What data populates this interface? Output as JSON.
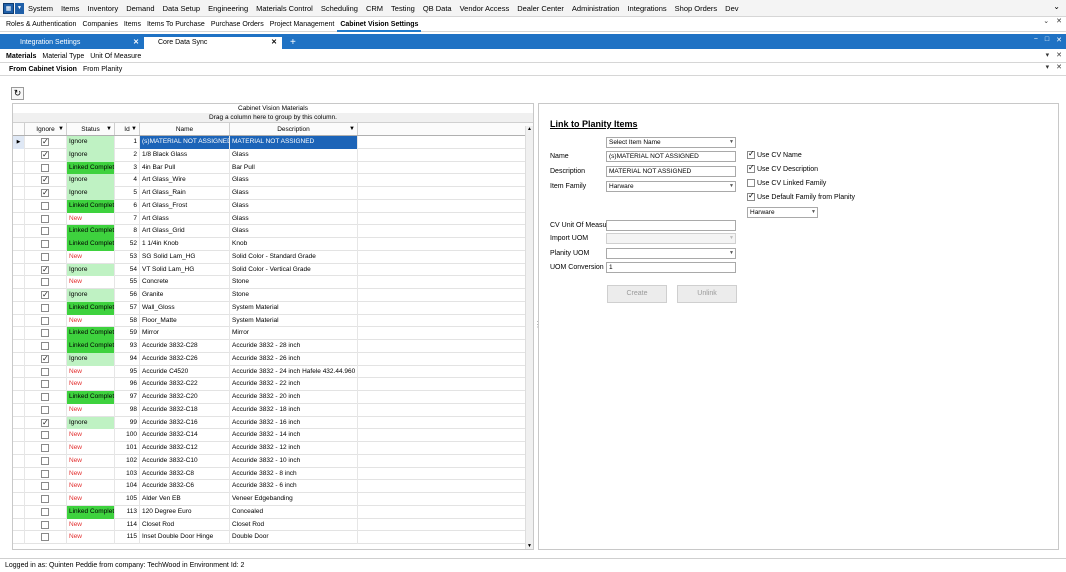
{
  "menubar": {
    "items": [
      "System",
      "Items",
      "Inventory",
      "Demand",
      "Data Setup",
      "Engineering",
      "Materials Control",
      "Scheduling",
      "CRM",
      "Testing",
      "QB Data",
      "Vendor Access",
      "Dealer Center",
      "Administration",
      "Integrations",
      "Shop Orders",
      "Dev"
    ],
    "collapse_glyph": "⌄"
  },
  "secnav": {
    "items": [
      "Roles & Authentication",
      "Companies",
      "Items",
      "Items To Purchase",
      "Purchase Orders",
      "Project Management",
      "Cabinet Vision Settings"
    ],
    "active_index": 6
  },
  "doc_tabs": {
    "tabs": [
      {
        "label": "Integration Settings",
        "active": false
      },
      {
        "label": "Core Data Sync",
        "active": true
      }
    ],
    "add": "+"
  },
  "sub_tabs": {
    "items": [
      "Materials",
      "Material Type",
      "Unit Of Measure"
    ],
    "active_index": 0
  },
  "source_tabs": {
    "items": [
      "From Cabinet Vision",
      "From Planity"
    ],
    "active_index": 0
  },
  "grid": {
    "title": "Cabinet Vision Materials",
    "drag_hint": "Drag a column here to group by this column.",
    "columns": [
      "Ignore",
      "Status",
      "Id",
      "Name",
      "Description"
    ],
    "rows": [
      {
        "ignore": true,
        "status": "Ignore",
        "id": "1",
        "name": "(s)MATERIAL NOT ASSIGNED",
        "desc": "MATERIAL NOT ASSIGNED",
        "selected": true
      },
      {
        "ignore": true,
        "status": "Ignore",
        "id": "2",
        "name": "1/8 Black Glass",
        "desc": "Glass"
      },
      {
        "ignore": false,
        "status": "Linked Complete",
        "id": "3",
        "name": "4in Bar Pull",
        "desc": "Bar Pull"
      },
      {
        "ignore": true,
        "status": "Ignore",
        "id": "4",
        "name": "Art Glass_Wire",
        "desc": "Glass"
      },
      {
        "ignore": true,
        "status": "Ignore",
        "id": "5",
        "name": "Art Glass_Rain",
        "desc": "Glass"
      },
      {
        "ignore": false,
        "status": "Linked Complete",
        "id": "6",
        "name": "Art Glass_Frost",
        "desc": "Glass"
      },
      {
        "ignore": false,
        "status": "New",
        "id": "7",
        "name": "Art Glass",
        "desc": "Glass"
      },
      {
        "ignore": false,
        "status": "Linked Complete",
        "id": "8",
        "name": "Art Glass_Grid",
        "desc": "Glass"
      },
      {
        "ignore": false,
        "status": "Linked Complete",
        "id": "52",
        "name": "1 1/4in Knob",
        "desc": "Knob"
      },
      {
        "ignore": false,
        "status": "New",
        "id": "53",
        "name": "SG Solid Lam_HG",
        "desc": "Solid Color - Standard Grade"
      },
      {
        "ignore": true,
        "status": "Ignore",
        "id": "54",
        "name": "VT Solid Lam_HG",
        "desc": "Solid Color - Vertical Grade"
      },
      {
        "ignore": false,
        "status": "New",
        "id": "55",
        "name": "Concrete",
        "desc": "Stone"
      },
      {
        "ignore": true,
        "status": "Ignore",
        "id": "56",
        "name": "Granite",
        "desc": "Stone"
      },
      {
        "ignore": false,
        "status": "Linked Complete",
        "id": "57",
        "name": "Wall_Gloss",
        "desc": "System Material"
      },
      {
        "ignore": false,
        "status": "New",
        "id": "58",
        "name": "Floor_Matte",
        "desc": "System Material"
      },
      {
        "ignore": false,
        "status": "Linked Complete",
        "id": "59",
        "name": "Mirror",
        "desc": "Mirror"
      },
      {
        "ignore": false,
        "status": "Linked Complete",
        "id": "93",
        "name": "Accuride 3832-C28",
        "desc": "Accuride 3832 - 28 inch"
      },
      {
        "ignore": true,
        "status": "Ignore",
        "id": "94",
        "name": "Accuride 3832-C26",
        "desc": "Accuride 3832 - 26 inch"
      },
      {
        "ignore": false,
        "status": "New",
        "id": "95",
        "name": "Accuride C4520",
        "desc": "Accuride 3832 - 24 inch Hafele 432.44.960"
      },
      {
        "ignore": false,
        "status": "New",
        "id": "96",
        "name": "Accuride 3832-C22",
        "desc": "Accuride 3832 - 22 inch"
      },
      {
        "ignore": false,
        "status": "Linked Complete",
        "id": "97",
        "name": "Accuride 3832-C20",
        "desc": "Accuride 3832 - 20 inch"
      },
      {
        "ignore": false,
        "status": "New",
        "id": "98",
        "name": "Accuride 3832-C18",
        "desc": "Accuride 3832 - 18 inch"
      },
      {
        "ignore": true,
        "status": "Ignore",
        "id": "99",
        "name": "Accuride 3832-C16",
        "desc": "Accuride 3832 - 16 inch"
      },
      {
        "ignore": false,
        "status": "New",
        "id": "100",
        "name": "Accuride 3832-C14",
        "desc": "Accuride 3832 - 14 inch"
      },
      {
        "ignore": false,
        "status": "New",
        "id": "101",
        "name": "Accuride 3832-C12",
        "desc": "Accuride 3832 - 12 inch"
      },
      {
        "ignore": false,
        "status": "New",
        "id": "102",
        "name": "Accuride 3832-C10",
        "desc": "Accuride 3832 - 10 inch"
      },
      {
        "ignore": false,
        "status": "New",
        "id": "103",
        "name": "Accuride 3832-C8",
        "desc": "Accuride 3832 - 8 inch"
      },
      {
        "ignore": false,
        "status": "New",
        "id": "104",
        "name": "Accuride 3832-C6",
        "desc": "Accuride 3832 - 6 inch"
      },
      {
        "ignore": false,
        "status": "New",
        "id": "105",
        "name": "Alder Ven EB",
        "desc": "Veneer Edgebanding"
      },
      {
        "ignore": false,
        "status": "Linked Complete",
        "id": "113",
        "name": "120 Degree Euro",
        "desc": "Concealed"
      },
      {
        "ignore": false,
        "status": "New",
        "id": "114",
        "name": "Closet Rod",
        "desc": "Closet Rod"
      },
      {
        "ignore": false,
        "status": "New",
        "id": "115",
        "name": "Inset Double Door Hinge",
        "desc": "Double Door"
      }
    ]
  },
  "form": {
    "title": "Link to Planity Items",
    "select_item": {
      "value": "Select Item Name"
    },
    "name": {
      "label": "Name",
      "value": "(s)MATERIAL NOT ASSIGNED"
    },
    "description": {
      "label": "Description",
      "value": "MATERIAL NOT ASSIGNED"
    },
    "item_family": {
      "label": "Item Family",
      "value": "Harware"
    },
    "cv_uom": {
      "label": "CV Unit Of Measure",
      "value": ""
    },
    "import_uom": {
      "label": "Import UOM",
      "value": ""
    },
    "planity_uom": {
      "label": "Planity UOM",
      "value": ""
    },
    "uom_conversion": {
      "label": "UOM Conversion",
      "value": "1"
    },
    "checks": [
      {
        "label": "Use CV Name",
        "checked": true
      },
      {
        "label": "Use CV Description",
        "checked": true
      },
      {
        "label": "Use CV Linked Family",
        "checked": false
      },
      {
        "label": "Use Default Family from Planity",
        "checked": true
      }
    ],
    "default_family": {
      "value": "Harware"
    },
    "create_label": "Create",
    "unlink_label": "Unlink"
  },
  "status_bar": {
    "text": "Logged in as: Quinten Peddie  from company: TechWood in Environment Id: 2"
  },
  "colors": {
    "accent": "#1f72c4",
    "linked": "#3ed23e",
    "ignore": "#bff2c3",
    "new_text": "#e33030",
    "selected": "#1c64b8"
  }
}
